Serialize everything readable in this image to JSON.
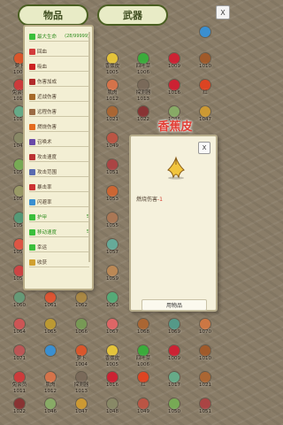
{
  "tabs": {
    "items": "物品",
    "weapons": "武器"
  },
  "main_close": "X",
  "stats": [
    {
      "label": "最大生命",
      "value": "(28/99999)",
      "color": "green",
      "icon": "heart-icon",
      "icon_color": "#3bbf3b"
    },
    {
      "label": "回血",
      "value": "",
      "color": "normal",
      "icon": "regen-icon",
      "icon_color": "#d23b3b"
    },
    {
      "label": "吸血",
      "value": "",
      "color": "normal",
      "icon": "vampire-icon",
      "icon_color": "#c22"
    },
    {
      "label": "伤害加成",
      "value": "",
      "color": "normal",
      "icon": "damage-icon",
      "icon_color": "#b12a2a"
    },
    {
      "label": "近战伤害",
      "value": "",
      "color": "normal",
      "icon": "melee-icon",
      "icon_color": "#a66a2a"
    },
    {
      "label": "远程伤害",
      "value": "",
      "color": "normal",
      "icon": "ranged-icon",
      "icon_color": "#9a6a44"
    },
    {
      "label": "燃烧伤害",
      "value": "",
      "color": "normal",
      "icon": "fire-icon",
      "icon_color": "#e46b1f"
    },
    {
      "label": "召唤术",
      "value": "",
      "color": "normal",
      "icon": "summon-icon",
      "icon_color": "#6a4aa8"
    },
    {
      "label": "攻击速度",
      "value": "",
      "color": "normal",
      "icon": "attack-speed-icon",
      "icon_color": "#b33"
    },
    {
      "label": "攻击范围",
      "value": "",
      "color": "normal",
      "icon": "attack-range-icon",
      "icon_color": "#5a6bb0"
    },
    {
      "label": "暴击率",
      "value": "",
      "color": "normal",
      "icon": "crit-icon",
      "icon_color": "#c33"
    },
    {
      "label": "闪避率",
      "value": "",
      "color": "normal",
      "icon": "dodge-icon",
      "icon_color": "#3a8fd0"
    },
    {
      "label": "护甲",
      "value": "5",
      "color": "green",
      "icon": "armor-icon",
      "icon_color": "#3bbf3b"
    },
    {
      "label": "移动速度",
      "value": "5",
      "color": "green",
      "icon": "move-speed-icon",
      "icon_color": "#3bbf3b"
    },
    {
      "label": "幸运",
      "value": "",
      "color": "normal",
      "icon": "luck-icon",
      "icon_color": "#3bbf3b"
    },
    {
      "label": "收获",
      "value": "",
      "color": "normal",
      "icon": "harvest-icon",
      "icon_color": "#d0a030"
    }
  ],
  "popup": {
    "title": "香蕉皮",
    "close": "X",
    "icon": "banana-peel-icon",
    "desc_label": "燃烧伤害",
    "desc_value": "-1",
    "use_button": "用物品"
  },
  "grid_items": [
    {
      "name": "",
      "num": "",
      "color": "#3a8fd0",
      "icon": "star-badge-icon"
    },
    {
      "name": "萝卜",
      "num": "1004",
      "color": "#d9562b",
      "icon": "radish-icon"
    },
    {
      "name": "香蕉皮",
      "num": "1005",
      "color": "#e4c33a",
      "icon": "banana-peel-icon"
    },
    {
      "name": "四叶草",
      "num": "1006",
      "color": "#3bab3b",
      "icon": "clover-icon"
    },
    {
      "name": "",
      "num": "1009",
      "color": "#c23",
      "icon": "item-icon"
    },
    {
      "name": "",
      "num": "1010",
      "color": "#a05a2a",
      "icon": "item-icon"
    },
    {
      "name": "免会员",
      "num": "1011",
      "color": "#cc3b3b",
      "icon": "item-icon"
    },
    {
      "name": "肌肉",
      "num": "1012",
      "color": "#d5734a",
      "icon": "muscle-icon"
    },
    {
      "name": "探测器",
      "num": "1013",
      "color": "#7a6a5a",
      "icon": "detector-icon"
    },
    {
      "name": "",
      "num": "1016",
      "color": "#c23",
      "icon": "item-icon"
    },
    {
      "name": "红",
      "num": "",
      "color": "#d42",
      "icon": "item-icon"
    },
    {
      "name": "",
      "num": "1017",
      "color": "#6a8",
      "icon": "item-icon"
    },
    {
      "name": "",
      "num": "1021",
      "color": "#a63",
      "icon": "item-icon"
    },
    {
      "name": "",
      "num": "1022",
      "color": "#833",
      "icon": "item-icon"
    },
    {
      "name": "",
      "num": "1046",
      "color": "#8a6",
      "icon": "item-icon"
    },
    {
      "name": "",
      "num": "1047",
      "color": "#c93",
      "icon": "item-icon"
    },
    {
      "name": "",
      "num": "1048",
      "color": "#886",
      "icon": "item-icon"
    },
    {
      "name": "",
      "num": "1049",
      "color": "#b54",
      "icon": "item-icon"
    },
    {
      "name": "",
      "num": "1050",
      "color": "#7a5",
      "icon": "item-icon"
    },
    {
      "name": "",
      "num": "1051",
      "color": "#a44",
      "icon": "item-icon"
    },
    {
      "name": "",
      "num": "1052",
      "color": "#996",
      "icon": "item-icon"
    },
    {
      "name": "",
      "num": "1053",
      "color": "#c63",
      "icon": "item-icon"
    },
    {
      "name": "",
      "num": "1054",
      "color": "#597",
      "icon": "item-icon"
    },
    {
      "name": "",
      "num": "1055",
      "color": "#a75",
      "icon": "item-icon"
    },
    {
      "name": "",
      "num": "1056",
      "color": "#d54",
      "icon": "item-icon"
    },
    {
      "name": "",
      "num": "1057",
      "color": "#6a9",
      "icon": "item-icon"
    },
    {
      "name": "",
      "num": "1058",
      "color": "#c44",
      "icon": "item-icon"
    },
    {
      "name": "",
      "num": "1059",
      "color": "#b85",
      "icon": "item-icon"
    },
    {
      "name": "",
      "num": "1060",
      "color": "#697",
      "icon": "item-icon"
    },
    {
      "name": "",
      "num": "1061",
      "color": "#d53",
      "icon": "item-icon"
    },
    {
      "name": "",
      "num": "1062",
      "color": "#a84",
      "icon": "item-icon"
    },
    {
      "name": "",
      "num": "1063",
      "color": "#5a7",
      "icon": "item-icon"
    },
    {
      "name": "",
      "num": "1064",
      "color": "#c55",
      "icon": "item-icon"
    },
    {
      "name": "",
      "num": "1065",
      "color": "#b93",
      "icon": "item-icon"
    },
    {
      "name": "",
      "num": "1066",
      "color": "#795",
      "icon": "item-icon"
    },
    {
      "name": "",
      "num": "1067",
      "color": "#d66",
      "icon": "item-icon"
    },
    {
      "name": "",
      "num": "1068",
      "color": "#a63",
      "icon": "item-icon"
    },
    {
      "name": "",
      "num": "1069",
      "color": "#598",
      "icon": "item-icon"
    },
    {
      "name": "",
      "num": "1070",
      "color": "#c74",
      "icon": "item-icon"
    },
    {
      "name": "",
      "num": "1071",
      "color": "#b55",
      "icon": "item-icon"
    }
  ]
}
